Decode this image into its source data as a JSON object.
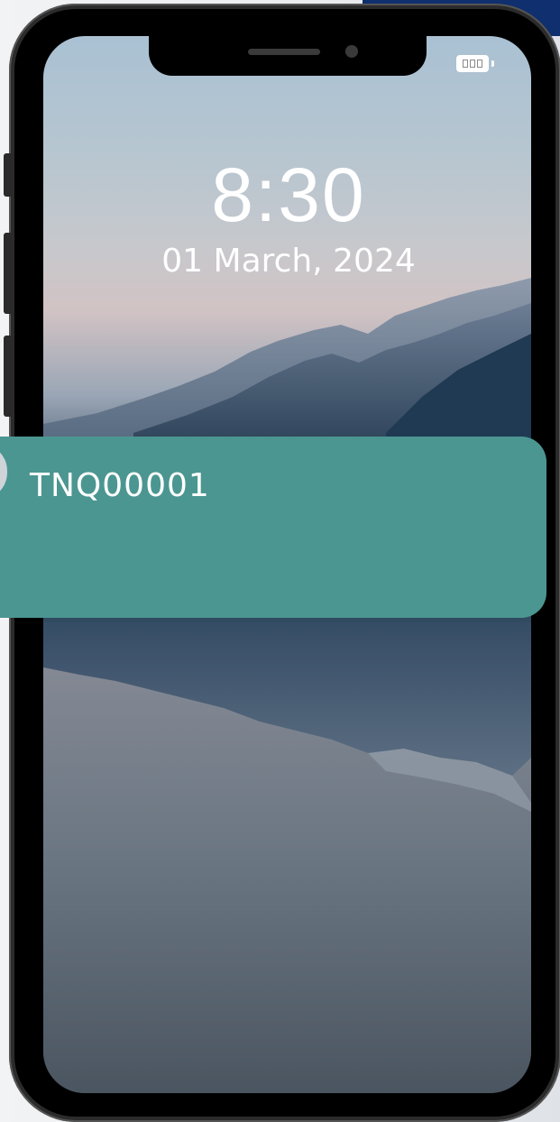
{
  "lock_screen": {
    "time": "8:30",
    "date": "01 March, 2024"
  },
  "notification": {
    "title": "TNQ00001",
    "background_color": "#4b9691"
  },
  "status_bar": {
    "battery_icon": "battery-icon"
  },
  "colors": {
    "phone_frame": "#2b2b2b",
    "backdrop_accent": "#0f2f6e",
    "text": "#ffffff"
  }
}
